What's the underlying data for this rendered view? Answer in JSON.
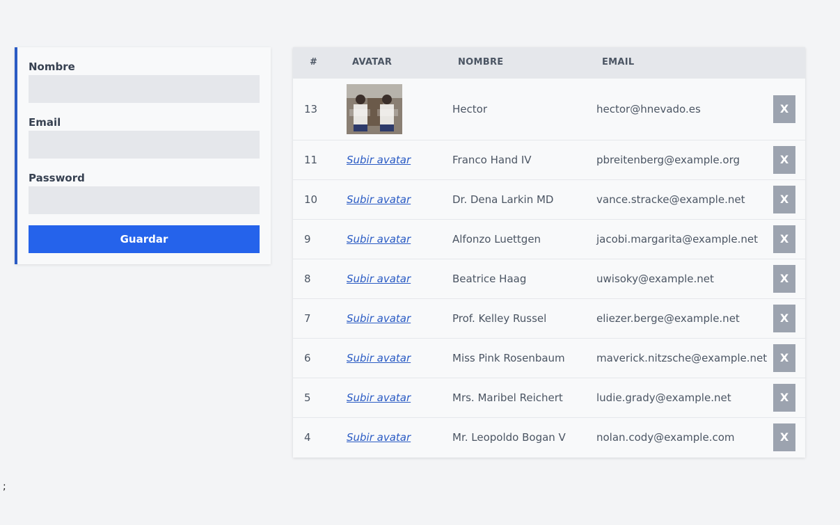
{
  "form": {
    "name_label": "Nombre",
    "email_label": "Email",
    "password_label": "Password",
    "name_value": "",
    "email_value": "",
    "password_value": "",
    "submit_label": "Guardar"
  },
  "table": {
    "headers": {
      "num": "#",
      "avatar": "AVATAR",
      "name": "NOMBRE",
      "email": "EMAIL"
    },
    "upload_label": "Subir avatar",
    "delete_label": "X",
    "rows": [
      {
        "id": "13",
        "has_avatar": true,
        "name": "Hector",
        "email": "hector@hnevado.es"
      },
      {
        "id": "11",
        "has_avatar": false,
        "name": "Franco Hand IV",
        "email": "pbreitenberg@example.org"
      },
      {
        "id": "10",
        "has_avatar": false,
        "name": "Dr. Dena Larkin MD",
        "email": "vance.stracke@example.net"
      },
      {
        "id": "9",
        "has_avatar": false,
        "name": "Alfonzo Luettgen",
        "email": "jacobi.margarita@example.net"
      },
      {
        "id": "8",
        "has_avatar": false,
        "name": "Beatrice Haag",
        "email": "uwisoky@example.net"
      },
      {
        "id": "7",
        "has_avatar": false,
        "name": "Prof. Kelley Russel",
        "email": "eliezer.berge@example.net"
      },
      {
        "id": "6",
        "has_avatar": false,
        "name": "Miss Pink Rosenbaum",
        "email": "maverick.nitzsche@example.net"
      },
      {
        "id": "5",
        "has_avatar": false,
        "name": "Mrs. Maribel Reichert",
        "email": "ludie.grady@example.net"
      },
      {
        "id": "4",
        "has_avatar": false,
        "name": "Mr. Leopoldo Bogan V",
        "email": "nolan.cody@example.com"
      }
    ]
  },
  "stray_text": ";",
  "colors": {
    "accent": "#2563eb",
    "border_accent": "#2a5bc4",
    "delete_button": "#9ca3af",
    "background": "#f3f4f6"
  }
}
